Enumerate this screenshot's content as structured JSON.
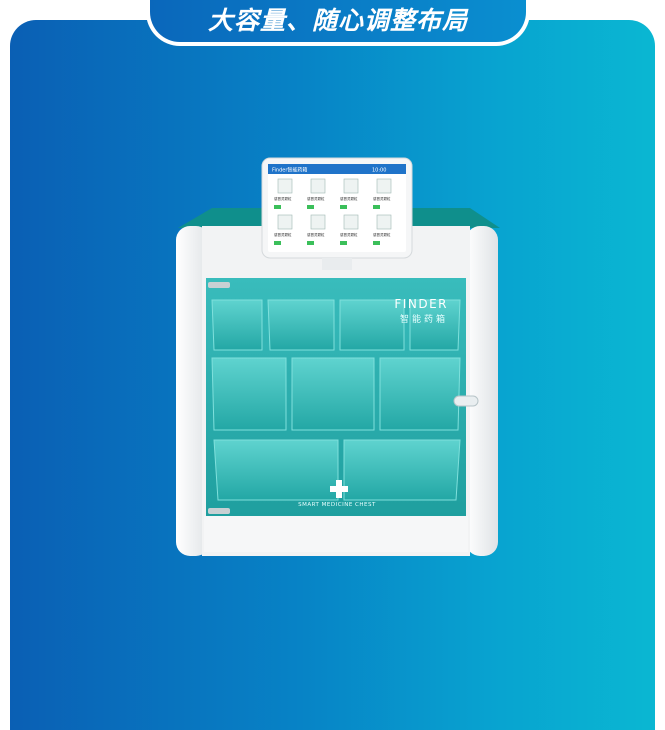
{
  "header": {
    "title": "大容量、随心调整布局"
  },
  "product": {
    "brand": "FINDER",
    "brand_cn": "智能药箱",
    "caption": "SMART MEDICINE CHEST",
    "colors": {
      "cabinet": "#1a9a9a",
      "body": "#f3f4f5",
      "glass": "#2fb3b3"
    }
  },
  "screen": {
    "app_title": "Finder智能药箱",
    "time": "10:00",
    "item_label": "感冒灵颗粒",
    "rows": 2,
    "cols": 4
  }
}
